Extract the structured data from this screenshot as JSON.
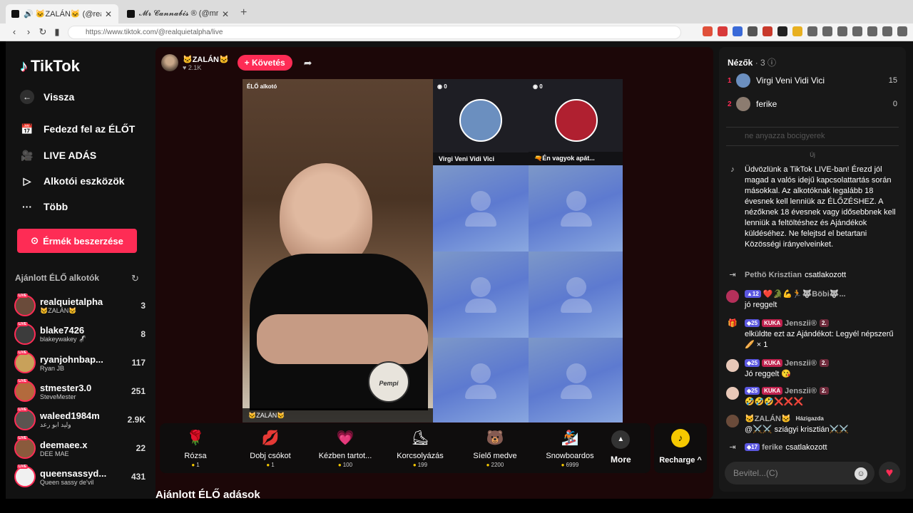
{
  "browser": {
    "tabs": [
      {
        "title": "🔊 🐱ZALÁN🐱 (@realquietalph"
      },
      {
        "title": "𝓜𝓻 𝓒𝓪𝓷𝓷𝓪𝓫𝓲𝓼 ® (@mrcannabis_"
      }
    ],
    "url": "https://www.tiktok.com/@realquietalpha/live"
  },
  "sidebar": {
    "logo": "TikTok",
    "menu": [
      {
        "label": "Vissza",
        "icon": "back-arrow-icon"
      },
      {
        "label": "Fedezd fel az ÉLŐT",
        "icon": "calendar-icon"
      },
      {
        "label": "LIVE ADÁS",
        "icon": "video-camera-icon"
      },
      {
        "label": "Alkotói eszközök",
        "icon": "creator-tools-icon"
      },
      {
        "label": "Több",
        "icon": "more-dots-icon"
      }
    ],
    "coins_button": "Érmék beszerzése",
    "suggested_title": "Ajánlott ÉLŐ alkotók",
    "creators": [
      {
        "name": "realquietalpha",
        "sub": "🐱ZALÁN🐱",
        "count": "3",
        "color": "#6a4b3a"
      },
      {
        "name": "blake7426",
        "sub": "blakeywakey 🦨",
        "count": "8",
        "color": "#3c3c3c"
      },
      {
        "name": "ryanjohnbap...",
        "sub": "Ryan JB",
        "count": "117",
        "color": "#c8a15a"
      },
      {
        "name": "stmester3.0",
        "sub": "SteveMester",
        "count": "251",
        "color": "#b36a3d"
      },
      {
        "name": "waleed1984m",
        "sub": "وليد ابو رعد",
        "count": "2.9K",
        "color": "#5c5450"
      },
      {
        "name": "deemaee.x",
        "sub": "DEE MAE",
        "count": "22",
        "color": "#8a5a3c"
      },
      {
        "name": "queensassyd...",
        "sub": "Queen sassy de'vil",
        "count": "431",
        "color": "#f0f0f0"
      }
    ]
  },
  "live": {
    "host_name": "🐱ZALÁN🐱",
    "likes": "♥ 2.1K",
    "follow_label": "+ Követés",
    "feed_label": "ÉLŐ alkotó",
    "feed_name": "🐱ZALÁN🐱",
    "seal_text": "Pempi",
    "guests": [
      {
        "count": "0",
        "name": "Virgi Veni Vidi Vici",
        "avatar_color": "#6b8fbf"
      },
      {
        "count": "0",
        "name": "🔫Én vagyok apát...",
        "avatar_color": "#b02030"
      }
    ],
    "gifts": [
      {
        "icon": "🌹",
        "name": "Rózsa",
        "price": "1"
      },
      {
        "icon": "💋",
        "name": "Dobj csókot",
        "price": "1"
      },
      {
        "icon": "💗",
        "name": "Kézben tartot...",
        "price": "100"
      },
      {
        "icon": "⛸",
        "name": "Korcsolyázás",
        "price": "199"
      },
      {
        "icon": "🐻",
        "name": "Síelő medve",
        "price": "2200"
      },
      {
        "icon": "🏂",
        "name": "Snowboardos",
        "price": "6999"
      }
    ],
    "more_label": "More",
    "recharge_label": "Recharge ^",
    "section_title": "Ajánlott ÉLŐ adások"
  },
  "chat": {
    "viewers_title": "Nézők",
    "viewers_count": "· 3",
    "viewers": [
      {
        "rank": "1",
        "name": "Virgi Veni Vidi Vici",
        "score": "15",
        "color": "#6b8fbf"
      },
      {
        "rank": "2",
        "name": "ferike",
        "score": "0",
        "color": "#8c7c70"
      }
    ],
    "faded_text": "ne anyazza bocigyerek",
    "date_sep": "Új",
    "welcome": "Üdvözlünk a TikTok LIVE-ban! Érezd jól magad a valós idejű kapcsolattartás során másokkal. Az alkotóknak legalább 18 évesnek kell lenniük az ÉLŐZÉSHEZ. A nézőknek 18 évesnek vagy idősebbnek kell lenniük a feltöltéshez és Ajándékok küldéséhez. Ne felejtsd el betartani Közösségi irányelveinket.",
    "messages": [
      {
        "type": "join",
        "user": "Pethö Krisztian",
        "text": "csatlakozott"
      },
      {
        "type": "msg",
        "badge_lvl": "12",
        "user": "❤️🐊💪🏃🐺Böbi🐺...",
        "text": "jó reggelt",
        "color": "#b5305a"
      },
      {
        "type": "gift",
        "badge_lvl": "25",
        "team": "KUKA",
        "user": "Jenszii®",
        "fan": "2.",
        "text": "elküldte ezt az Ajándékot: Legyél népszerű 🥖 × 1"
      },
      {
        "type": "msg",
        "badge_lvl": "25",
        "team": "KUKA",
        "user": "Jenszii®",
        "fan": "2.",
        "text": "Jó reggelt 😘",
        "color": "#e8c8b8"
      },
      {
        "type": "msg",
        "badge_lvl": "25",
        "team": "KUKA",
        "user": "Jenszii®",
        "fan": "2.",
        "text": "🤣🤣🤣❌❌❌",
        "color": "#e8c8b8"
      },
      {
        "type": "msg",
        "user": "🐱ZALÁN🐱",
        "tag": "Házigazda",
        "text": "@⚔️⚔️ sziágyi krisztián⚔️⚔️",
        "color": "#6a4b3a"
      },
      {
        "type": "join",
        "badge_lvl": "17",
        "user": "ferike",
        "text": "csatlakozott"
      }
    ],
    "input_placeholder": "Bevitel...(C)"
  }
}
